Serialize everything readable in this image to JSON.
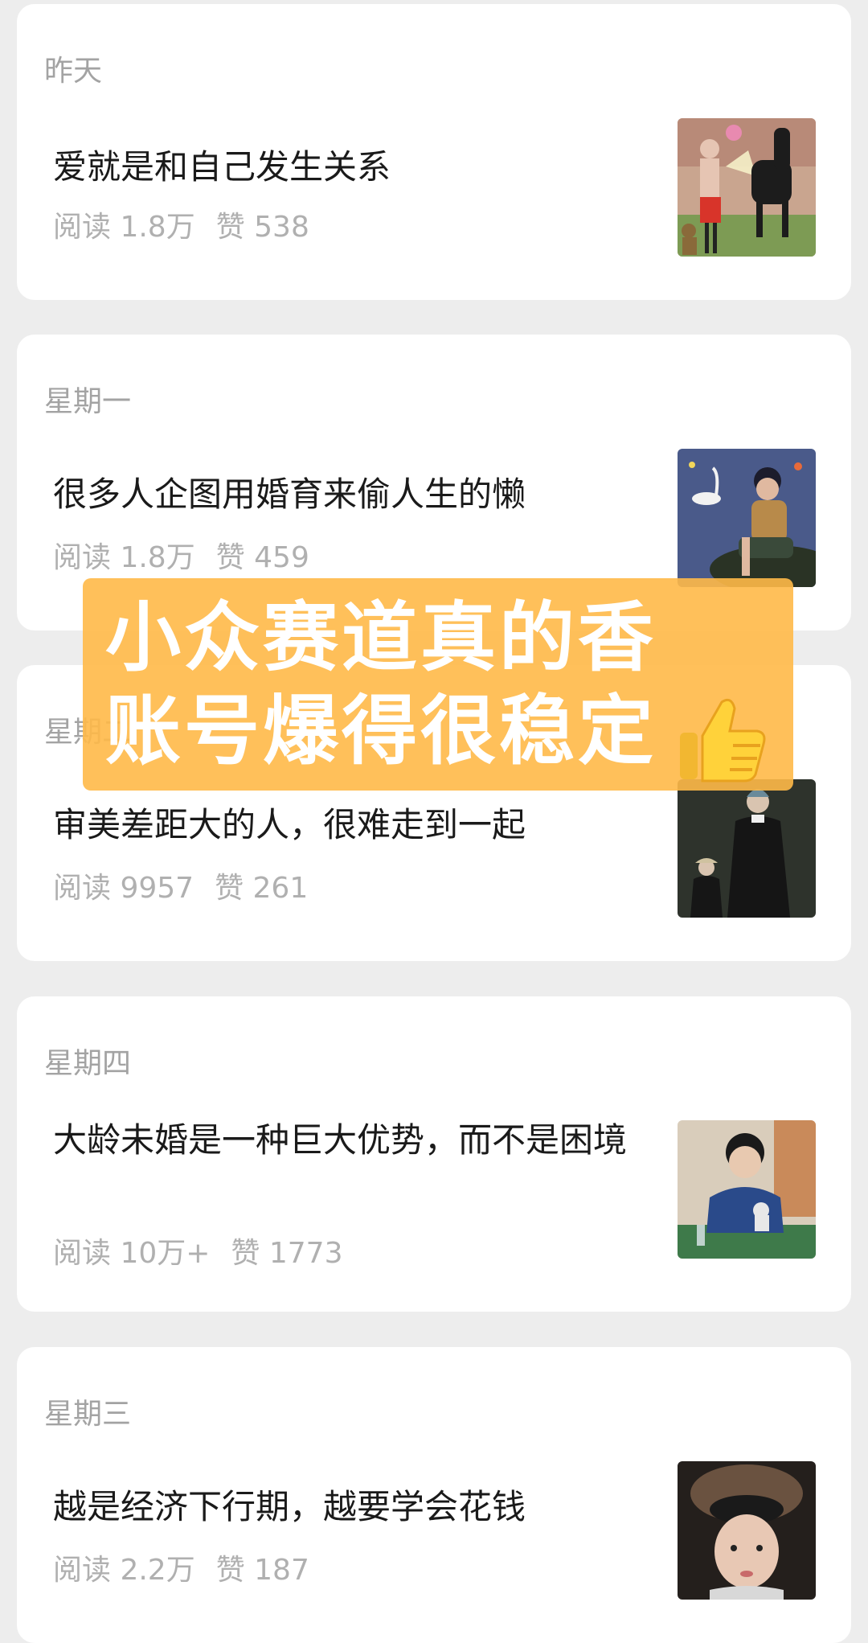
{
  "articles": [
    {
      "date": "昨天",
      "title": "爱就是和自己发生关系",
      "reads": "阅读 1.8万",
      "likes": "赞 538",
      "thumb": "thumb-boy-donkey"
    },
    {
      "date": "星期一",
      "title": "很多人企图用婚育来偷人生的懒",
      "reads": "阅读 1.8万",
      "likes": "赞 459",
      "thumb": "thumb-boy-swan"
    },
    {
      "date": "星期二",
      "title": "审美差距大的人，很难走到一起",
      "reads": "阅读 9957",
      "likes": "赞 261",
      "thumb": "thumb-dark-figures"
    },
    {
      "date": "星期四",
      "title": "大龄未婚是一种巨大优势，而不是困境",
      "reads": "阅读 10万+",
      "likes": "赞 1773",
      "thumb": "thumb-woman-cat"
    },
    {
      "date": "星期三",
      "title": "越是经济下行期，越要学会花钱",
      "reads": "阅读 2.2万",
      "likes": "赞 187",
      "thumb": "thumb-woman-hat"
    }
  ],
  "banner": {
    "line1": "小众赛道真的香",
    "line2": "账号爆得很稳定",
    "icon": "thumbs-up-emoji",
    "color": "#ffb948"
  }
}
